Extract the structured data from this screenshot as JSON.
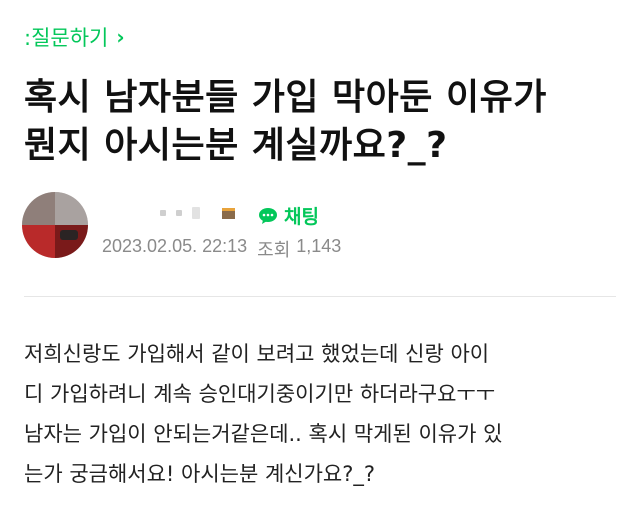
{
  "category": {
    "label": ":질문하기",
    "chevron": "›"
  },
  "post": {
    "title_lines": [
      "혹시 남자분들 가입 막아둔 이유가",
      "뭔지 아시는분 계실까요?_?"
    ],
    "chat_label": "채팅",
    "date": "2023.02.05. 22:13",
    "views_label": "조회",
    "views": "1,143",
    "body_lines": [
      "저희신랑도 가입해서 같이 보려고 했었는데 신랑 아이",
      "디 가입하려니 계속 승인대기중이기만 하더라구요ㅜㅜ",
      "남자는 가입이 안되는거같은데.. 혹시 막게된 이유가 있",
      "는가 궁금해서요! 아시는분 계신가요?_?"
    ]
  },
  "icons": {
    "chat": "chat-bubble-icon",
    "level": "level-badge-icon",
    "category": "chevron-right-icon"
  },
  "colors": {
    "accent": "#03c75a",
    "meta": "#8a8a8a",
    "text": "#222222"
  }
}
